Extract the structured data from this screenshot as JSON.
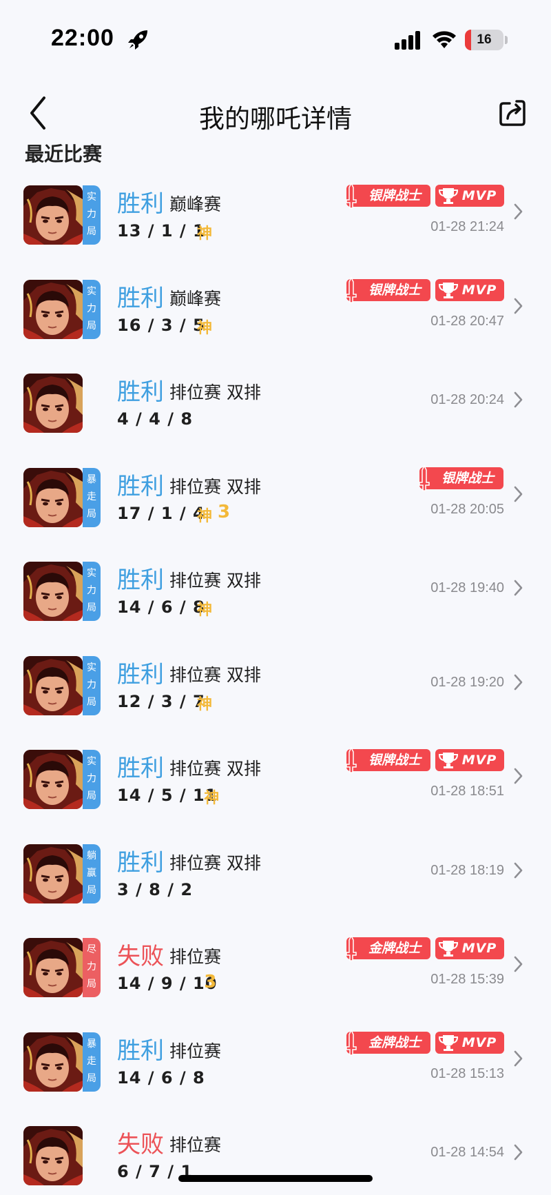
{
  "status_bar": {
    "time": "22:00",
    "battery": "16",
    "battery_level_percent": 16,
    "icons": [
      "rocket-icon",
      "cellular-signal-icon",
      "wifi-icon",
      "battery-icon"
    ]
  },
  "nav": {
    "title": "我的哪吒详情",
    "back_icon": "chevron-left-icon",
    "share_icon": "share-icon"
  },
  "section_title": "最近比赛",
  "colors": {
    "win": "#3f9fe0",
    "loss": "#ec5257",
    "tier_blue": "#4a9fe6",
    "tier_red": "#ec5f62",
    "honor": "#f3484e",
    "highlight": "#f3b93a"
  },
  "matches": [
    {
      "result": "胜利",
      "outcome": "win",
      "mode": "巅峰赛",
      "kda": "13 / 1 / 1",
      "shen": "神",
      "three": "",
      "tier": "实力局",
      "tier_color": "blue",
      "medal": "银牌战士",
      "mvp": "MVP",
      "time": "01-28 21:24"
    },
    {
      "result": "胜利",
      "outcome": "win",
      "mode": "巅峰赛",
      "kda": "16 / 3 / 5",
      "shen": "神",
      "three": "",
      "tier": "实力局",
      "tier_color": "blue",
      "medal": "银牌战士",
      "mvp": "MVP",
      "time": "01-28 20:47"
    },
    {
      "result": "胜利",
      "outcome": "win",
      "mode": "排位赛 双排",
      "kda": "4 / 4 / 8",
      "shen": "",
      "three": "",
      "tier": "",
      "tier_color": "",
      "medal": "",
      "mvp": "",
      "time": "01-28 20:24"
    },
    {
      "result": "胜利",
      "outcome": "win",
      "mode": "排位赛 双排",
      "kda": "17 / 1 / 4",
      "shen": "神",
      "three": "3",
      "tier": "暴走局",
      "tier_color": "blue",
      "medal": "银牌战士",
      "mvp": "",
      "time": "01-28 20:05"
    },
    {
      "result": "胜利",
      "outcome": "win",
      "mode": "排位赛 双排",
      "kda": "14 / 6 / 8",
      "shen": "神",
      "three": "",
      "tier": "实力局",
      "tier_color": "blue",
      "medal": "",
      "mvp": "",
      "time": "01-28 19:40"
    },
    {
      "result": "胜利",
      "outcome": "win",
      "mode": "排位赛 双排",
      "kda": "12 / 3 / 7",
      "shen": "神",
      "three": "",
      "tier": "实力局",
      "tier_color": "blue",
      "medal": "",
      "mvp": "",
      "time": "01-28 19:20"
    },
    {
      "result": "胜利",
      "outcome": "win",
      "mode": "排位赛 双排",
      "kda": "14 / 5 / 11",
      "shen": "神",
      "three": "",
      "tier": "实力局",
      "tier_color": "blue",
      "medal": "银牌战士",
      "mvp": "MVP",
      "time": "01-28 18:51"
    },
    {
      "result": "胜利",
      "outcome": "win",
      "mode": "排位赛 双排",
      "kda": "3 / 8 / 2",
      "shen": "",
      "three": "",
      "tier": "躺赢局",
      "tier_color": "blue",
      "medal": "",
      "mvp": "",
      "time": "01-28 18:19"
    },
    {
      "result": "失败",
      "outcome": "loss",
      "mode": "排位赛",
      "kda": "14 / 9 / 10",
      "shen": "",
      "three": "3",
      "tier": "尽力局",
      "tier_color": "red",
      "medal": "金牌战士",
      "mvp": "MVP",
      "time": "01-28 15:39"
    },
    {
      "result": "胜利",
      "outcome": "win",
      "mode": "排位赛",
      "kda": "14 / 6 / 8",
      "shen": "",
      "three": "",
      "tier": "暴走局",
      "tier_color": "blue",
      "medal": "金牌战士",
      "mvp": "MVP",
      "time": "01-28 15:13"
    },
    {
      "result": "失败",
      "outcome": "loss",
      "mode": "排位赛",
      "kda": "6 / 7 / 1",
      "shen": "",
      "three": "",
      "tier": "",
      "tier_color": "",
      "medal": "",
      "mvp": "",
      "time": "01-28 14:54"
    }
  ]
}
